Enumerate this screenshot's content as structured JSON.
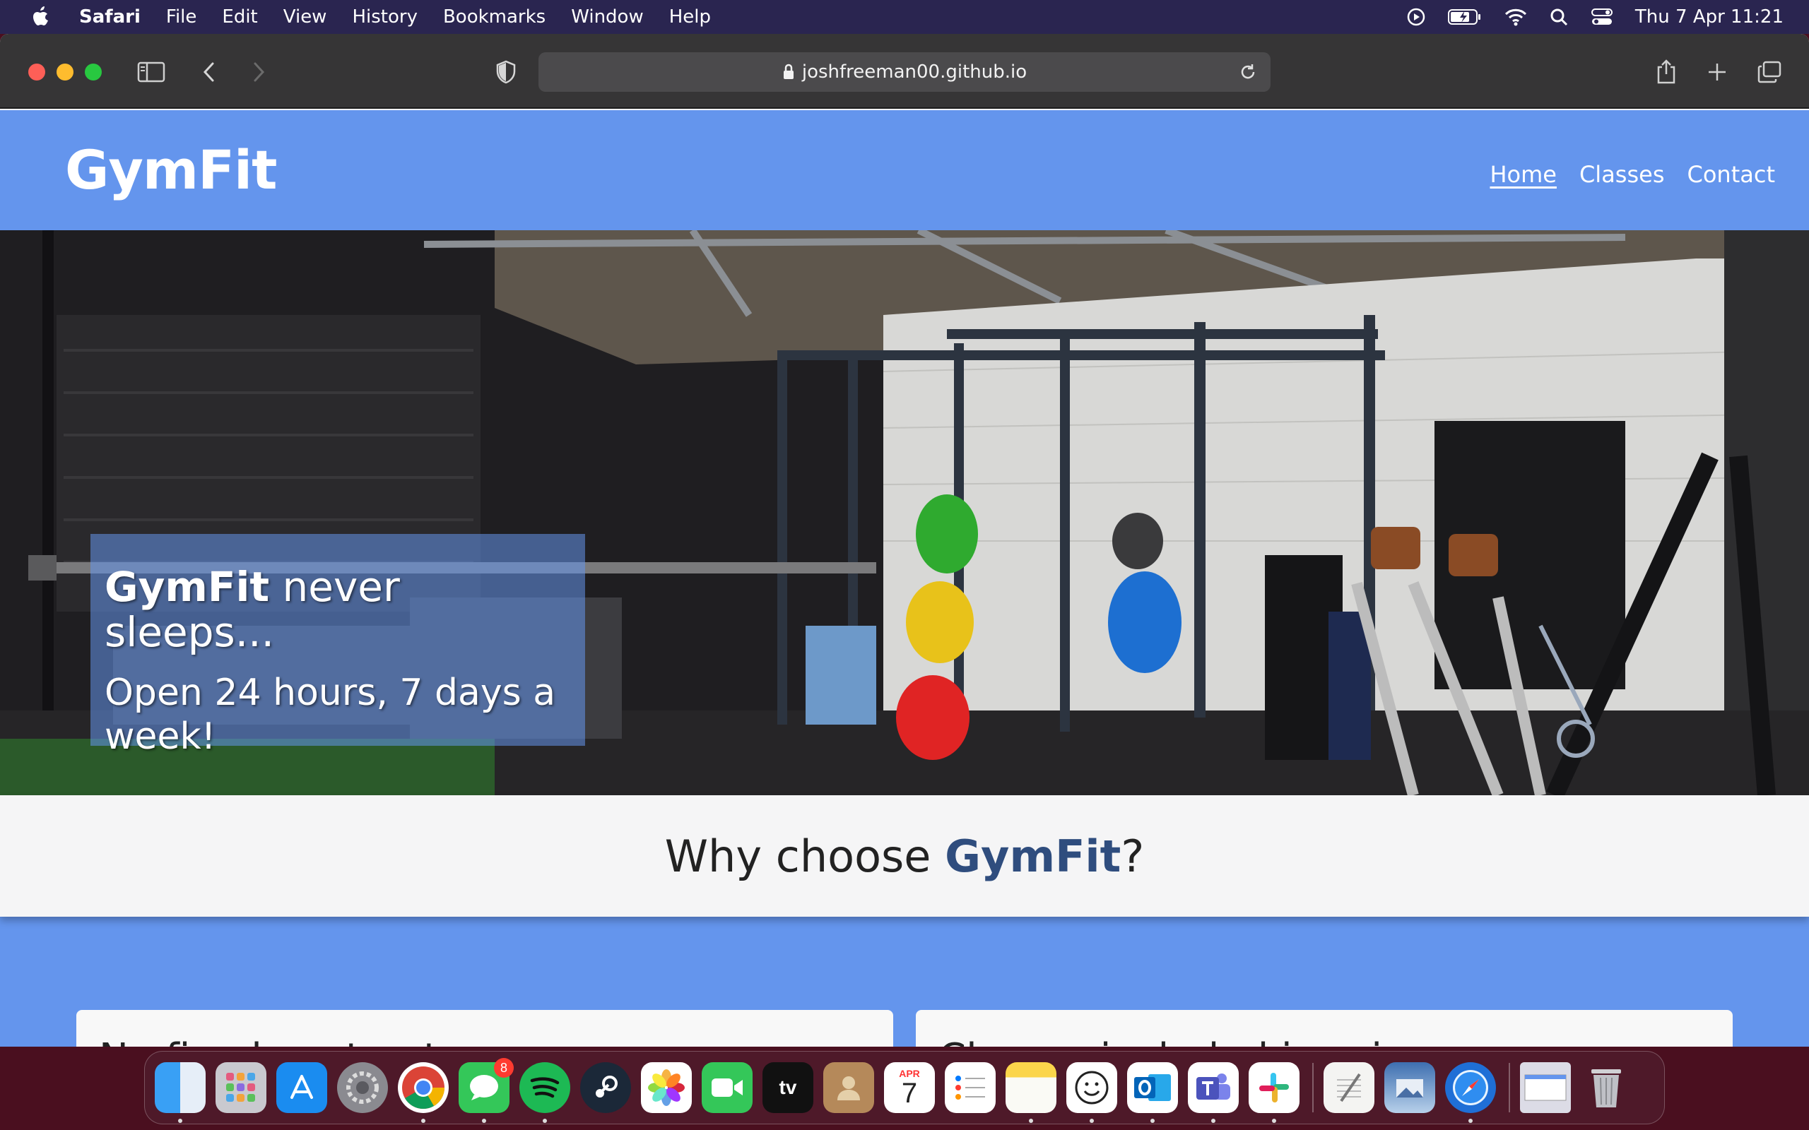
{
  "menubar": {
    "app_name": "Safari",
    "items": [
      "File",
      "Edit",
      "View",
      "History",
      "Bookmarks",
      "Window",
      "Help"
    ],
    "clock": "Thu 7 Apr  11:21",
    "status_icons": [
      "play-icon",
      "battery-icon",
      "wifi-icon",
      "search-icon",
      "control-center-icon"
    ]
  },
  "browser": {
    "url": "joshfreeman00.github.io"
  },
  "site": {
    "logo": "GymFit",
    "nav": [
      "Home",
      "Classes",
      "Contact"
    ],
    "active_nav": "Home",
    "hero": {
      "title_brand": "GymFit",
      "title_rest": " never sleeps...",
      "subtitle": "Open 24 hours, 7 days a week!"
    },
    "why": {
      "prefix": "Why choose ",
      "brand": "GymFit",
      "suffix": "?"
    },
    "cards": [
      {
        "title": "No fixed contract"
      },
      {
        "title": "Classes included in price"
      }
    ],
    "colors": {
      "primary": "#6495ed",
      "brand_dark": "#2f4d7e"
    }
  },
  "dock": {
    "apps": [
      "Finder",
      "Launchpad",
      "App Store",
      "System Preferences",
      "Chrome",
      "Messages",
      "Spotify",
      "Steam",
      "Photos",
      "FaceTime",
      "TV",
      "Contacts",
      "Calendar",
      "Reminders",
      "Notes",
      "Memoji",
      "Outlook",
      "Teams",
      "Slack"
    ],
    "messages_badge": "8",
    "calendar_month": "APR",
    "calendar_day": "7",
    "tv_label": "tv"
  }
}
